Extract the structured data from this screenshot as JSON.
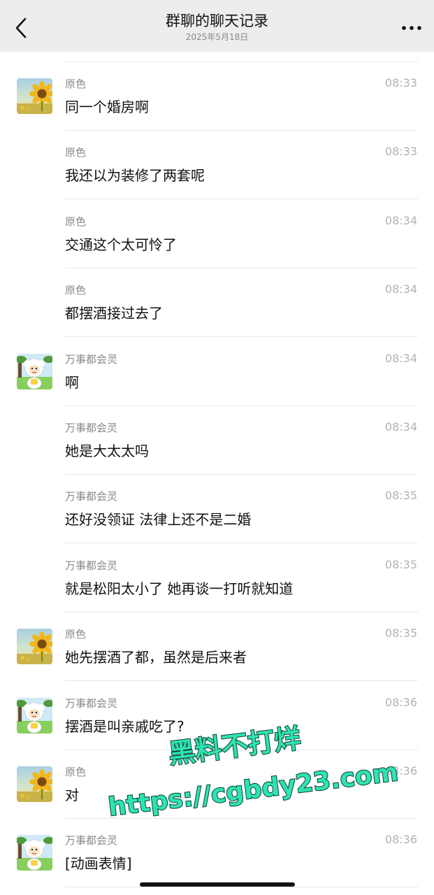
{
  "header": {
    "title": "群聊的聊天记录",
    "date": "2025年5月18日",
    "back_icon": "chevron-left-icon",
    "more_icon": "more-horizontal-icon"
  },
  "messages": [
    {
      "sender": "原色",
      "time": "08:33",
      "text": "同一个婚房啊",
      "avatar": "sunflower"
    },
    {
      "sender": "原色",
      "time": "08:33",
      "text": "我还以为装修了两套呢",
      "avatar": ""
    },
    {
      "sender": "原色",
      "time": "08:34",
      "text": "交通这个太可怜了",
      "avatar": ""
    },
    {
      "sender": "原色",
      "time": "08:34",
      "text": "都摆酒接过去了",
      "avatar": ""
    },
    {
      "sender": "万事都会灵",
      "time": "08:34",
      "text": "啊",
      "avatar": "sheep"
    },
    {
      "sender": "万事都会灵",
      "time": "08:34",
      "text": "她是大太太吗",
      "avatar": ""
    },
    {
      "sender": "万事都会灵",
      "time": "08:35",
      "text": "还好没领证 法律上还不是二婚",
      "avatar": ""
    },
    {
      "sender": "万事都会灵",
      "time": "08:35",
      "text": "就是松阳太小了 她再谈一打听就知道",
      "avatar": ""
    },
    {
      "sender": "原色",
      "time": "08:35",
      "text": "她先摆酒了都，虽然是后来者",
      "avatar": "sunflower"
    },
    {
      "sender": "万事都会灵",
      "time": "08:36",
      "text": "摆酒是叫亲戚吃了?",
      "avatar": "sheep"
    },
    {
      "sender": "原色",
      "time": "08:36",
      "text": "对",
      "avatar": "sunflower"
    },
    {
      "sender": "万事都会灵",
      "time": "08:36",
      "text": "[动画表情]",
      "avatar": "sheep"
    }
  ],
  "watermark": {
    "line1": "黑料不打烊",
    "line2": "https://cgbdy23.com",
    "color": "#2ee3b2"
  },
  "colors": {
    "header_bg": "#ededed",
    "name": "#888888",
    "time": "#b2b2b2",
    "separator": "#e6e6e6"
  }
}
